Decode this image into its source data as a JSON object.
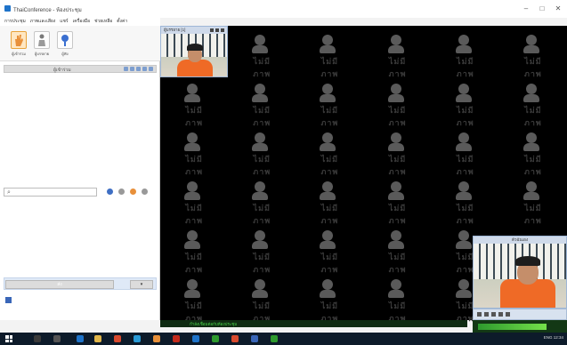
{
  "window": {
    "title": "ThaiConference - ห้องประชุม",
    "controls": [
      "–",
      "□",
      "✕"
    ]
  },
  "menu": [
    "การประชุม",
    "ภาพและเสียง",
    "แชร์",
    "เครื่องมือ",
    "ช่วยเหลือ",
    "ตั้งค่า"
  ],
  "toolbar": {
    "buttons": [
      {
        "label": "ผู้เข้าร่วม",
        "icon": "hand-icon",
        "selected": true
      },
      {
        "label": "ผู้บรรยาย",
        "icon": "presenter-icon",
        "selected": false
      },
      {
        "label": "ผู้ฟัง",
        "icon": "listener-icon",
        "selected": false
      }
    ]
  },
  "participants": {
    "header": "ผู้เข้าร่วม"
  },
  "chat": {
    "send_label": "ส่ง",
    "drop_label": "▾"
  },
  "video": {
    "main_tile_title": "ผู้บรรยาย [1]",
    "self_tile_title": "ตัวฉันเอง",
    "placeholder_text": "ไม่มีภาพ",
    "grid": {
      "columns": 6,
      "rows": 6
    },
    "status_text": "กำลังเชื่อมต่อกับห้องประชุม",
    "mic_level": 0.82
  },
  "taskbar": {
    "tray_text": "ENG  12:34"
  },
  "colors": {
    "accent": "#1e73c9",
    "shirt": "#ef6a26",
    "video_bg": "#000000",
    "status_green": "#48d448"
  }
}
